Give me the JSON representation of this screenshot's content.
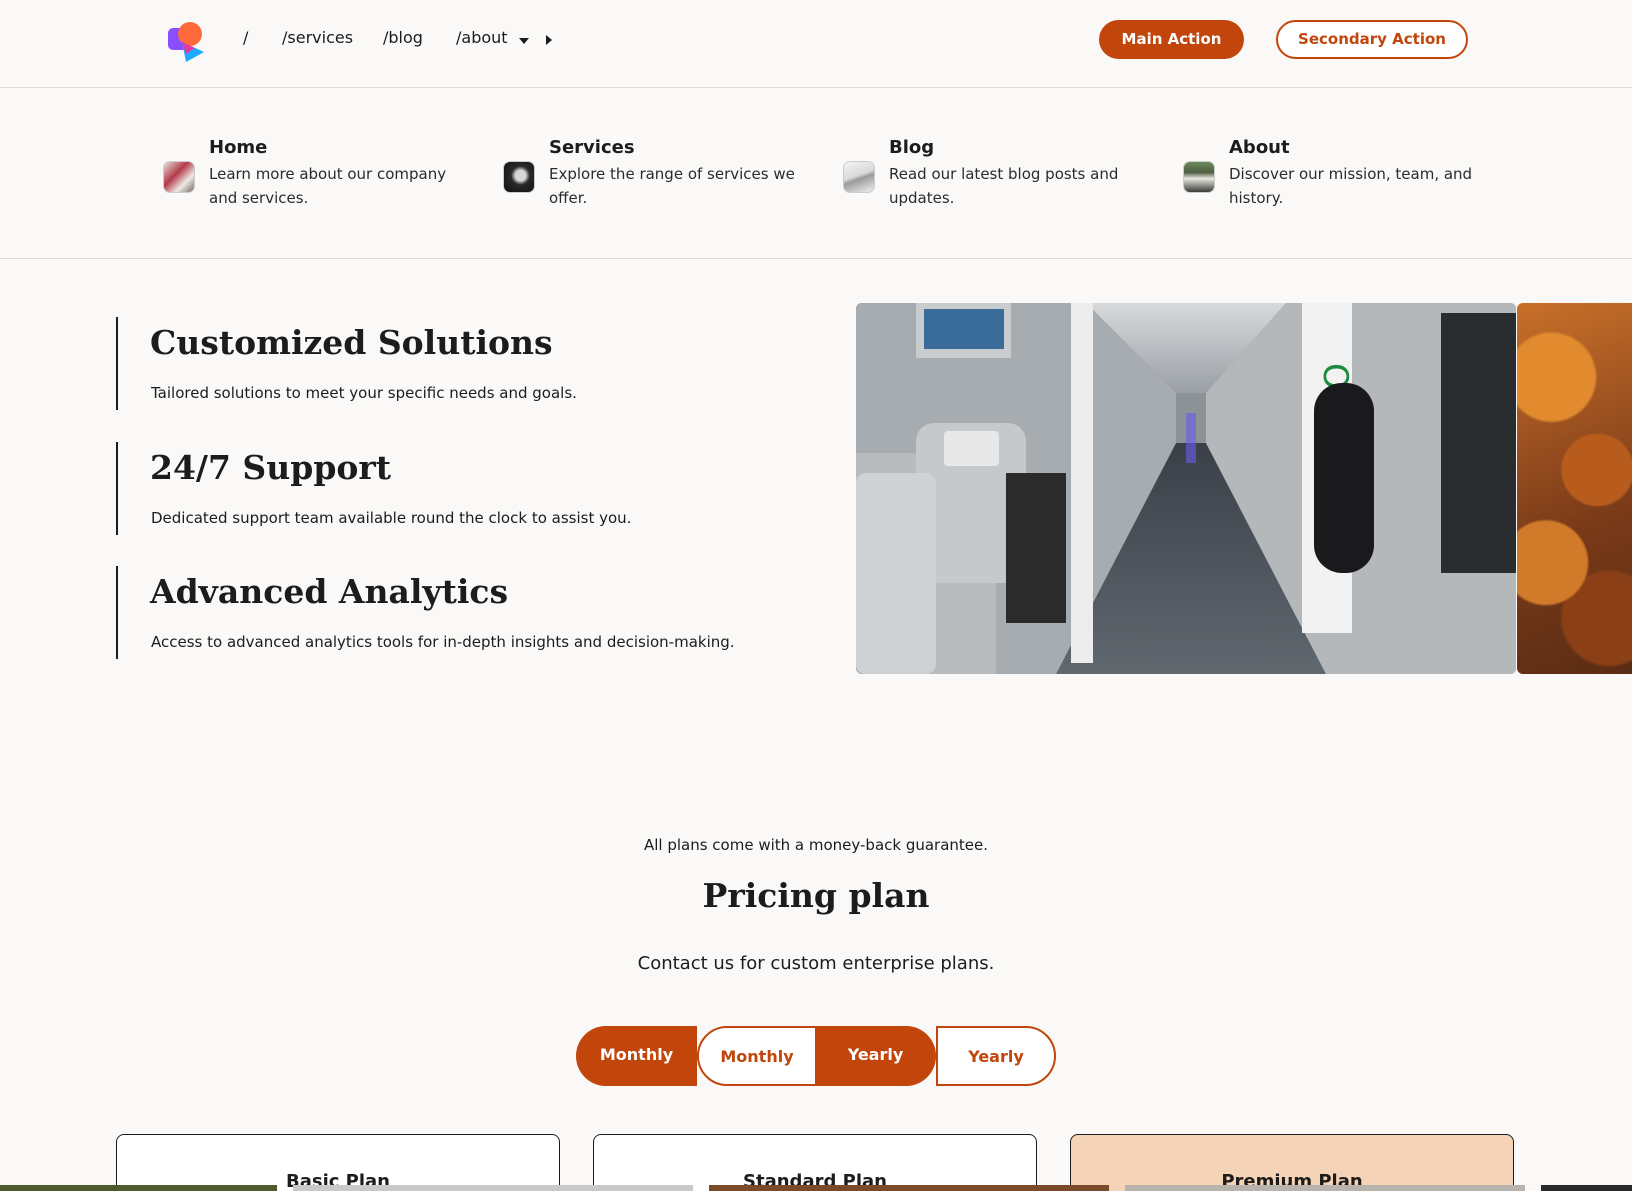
{
  "nav": {
    "links": [
      "/",
      "/services",
      "/blog",
      "/about"
    ],
    "main_action": "Main Action",
    "secondary_action": "Secondary Action"
  },
  "mega_menu": [
    {
      "title": "Home",
      "description": "Learn more about our company and services."
    },
    {
      "title": "Services",
      "description": "Explore the range of services we offer."
    },
    {
      "title": "Blog",
      "description": "Read our latest blog posts and updates."
    },
    {
      "title": "About",
      "description": "Discover our mission, team, and history."
    }
  ],
  "features": [
    {
      "title": "Customized Solutions",
      "description": "Tailored solutions to meet your specific needs and goals."
    },
    {
      "title": "24/7 Support",
      "description": "Dedicated support team available round the clock to assist you."
    },
    {
      "title": "Advanced Analytics",
      "description": "Access to advanced analytics tools for in-depth insights and decision-making."
    }
  ],
  "pricing": {
    "guarantee": "All plans come with a money-back guarantee.",
    "title": "Pricing plan",
    "subtitle": "Contact us for custom enterprise plans.",
    "toggle": [
      "Monthly",
      "Monthly",
      "Yearly",
      "Yearly"
    ],
    "plans": [
      "Basic Plan",
      "Standard Plan",
      "Premium Plan"
    ]
  },
  "colors": {
    "accent": "#c2450c",
    "premium_card": "#f5d3b6",
    "background": "#faf9f7"
  }
}
